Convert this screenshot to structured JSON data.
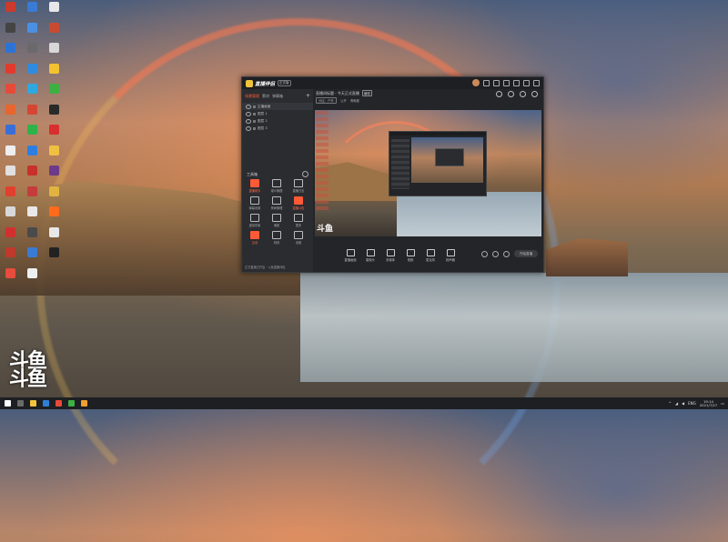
{
  "desktop": {
    "icons": [
      {
        "label": "",
        "color": "#cc3a2c"
      },
      {
        "label": "",
        "color": "#3a7bd5"
      },
      {
        "label": "",
        "color": "#e8e8e8"
      },
      {
        "label": "",
        "color": "#444444"
      },
      {
        "label": "",
        "color": "#4a90e2"
      },
      {
        "label": "",
        "color": "#c84b31"
      },
      {
        "label": "",
        "color": "#2b74d6"
      },
      {
        "label": "",
        "color": "#6a6a6a"
      },
      {
        "label": "",
        "color": "#d8d8d8"
      },
      {
        "label": "",
        "color": "#e23b2e"
      },
      {
        "label": "",
        "color": "#2f8be0"
      },
      {
        "label": "",
        "color": "#f2c230"
      },
      {
        "label": "",
        "color": "#e84a3a"
      },
      {
        "label": "",
        "color": "#2da8e1"
      },
      {
        "label": "",
        "color": "#3cb043"
      },
      {
        "label": "",
        "color": "#e8652d"
      },
      {
        "label": "",
        "color": "#d64533"
      },
      {
        "label": "",
        "color": "#2a2a2a"
      },
      {
        "label": "",
        "color": "#3b6fd8"
      },
      {
        "label": "",
        "color": "#2fb24a"
      },
      {
        "label": "",
        "color": "#d82f2f"
      },
      {
        "label": "",
        "color": "#eeeeee"
      },
      {
        "label": "",
        "color": "#2c7fe0"
      },
      {
        "label": "",
        "color": "#f0c040"
      },
      {
        "label": "",
        "color": "#e0e0e0"
      },
      {
        "label": "",
        "color": "#c8302c"
      },
      {
        "label": "",
        "color": "#6b3a8a"
      },
      {
        "label": "",
        "color": "#e2402e"
      },
      {
        "label": "",
        "color": "#c43c3c"
      },
      {
        "label": "",
        "color": "#e3b341"
      },
      {
        "label": "",
        "color": "#d8d8d8"
      },
      {
        "label": "",
        "color": "#e8e8e8"
      },
      {
        "label": "",
        "color": "#ff6b1a"
      },
      {
        "label": "",
        "color": "#d22f2f"
      },
      {
        "label": "",
        "color": "#4a4a4a"
      },
      {
        "label": "",
        "color": "#e8e8e8"
      },
      {
        "label": "",
        "color": "#c0392b"
      },
      {
        "label": "",
        "color": "#3a7bd5"
      },
      {
        "label": "",
        "color": "#222222"
      },
      {
        "label": "",
        "color": "#e74c3c"
      },
      {
        "label": "",
        "color": "#ecf0f1"
      }
    ]
  },
  "watermark": {
    "line1": "斗鱼",
    "line2": "斗鱼"
  },
  "app": {
    "name": "直播伴侣",
    "version": "正式版",
    "left": {
      "tabs": [
        "场景管理",
        "素材",
        "弹幕箱"
      ],
      "add": "+",
      "scenes": [
        "主播画面",
        "图层 1",
        "图层 2",
        "图层 3"
      ],
      "tools_title": "工具箱",
      "tools": [
        {
          "label": "直播助手",
          "hot": true
        },
        {
          "label": "观众管理",
          "hot": false
        },
        {
          "label": "直播日志",
          "hot": false
        },
        {
          "label": "弹幕设置",
          "hot": false
        },
        {
          "label": "房间管理",
          "hot": false
        },
        {
          "label": "直播公告",
          "hot": true
        },
        {
          "label": "虚拟形象",
          "hot": false
        },
        {
          "label": "美颜",
          "hot": false
        },
        {
          "label": "更多",
          "hot": false
        },
        {
          "label": "互动",
          "hot": true
        },
        {
          "label": "特效",
          "hot": false
        },
        {
          "label": "设置",
          "hot": false
        }
      ],
      "footer": "正式直播已开启 · 斗鱼直播伴侣"
    },
    "main": {
      "room_title": "直播间标题 · 今天正式直播",
      "room_tag": "编辑",
      "chips": [
        "分区：户外",
        "公开",
        "清晰度"
      ],
      "watermark": "斗鱼",
      "controls": [
        {
          "label": "直播画面",
          "icon": "monitor-icon"
        },
        {
          "label": "摄像头",
          "icon": "camera-icon"
        },
        {
          "label": "多媒体",
          "icon": "media-icon"
        },
        {
          "label": "视频",
          "icon": "video-icon"
        },
        {
          "label": "麦克风",
          "icon": "mic-icon"
        },
        {
          "label": "扬声器",
          "icon": "speaker-icon"
        }
      ],
      "go_live": "开始直播"
    }
  },
  "taskbar": {
    "items": [
      {
        "color": "#ffffff"
      },
      {
        "color": "#6b6b6b"
      },
      {
        "color": "#f0c33c"
      },
      {
        "color": "#2f7fd6"
      },
      {
        "color": "#e84a3a"
      },
      {
        "color": "#3cb043"
      },
      {
        "color": "#f0a030"
      }
    ],
    "lang": "ENG",
    "time": "19:14",
    "date": "2021/7/27"
  }
}
